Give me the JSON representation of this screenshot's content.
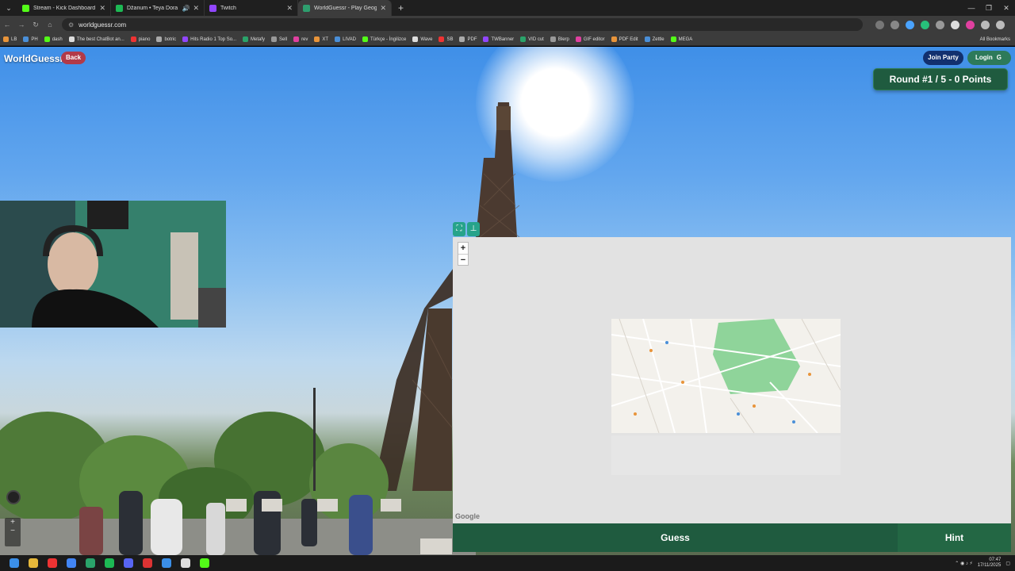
{
  "browser": {
    "tabs": [
      {
        "title": "Stream - Kick Dashboard",
        "color": "#53fc18",
        "active": false
      },
      {
        "title": "Džanum • Teya Dora",
        "color": "#1db954",
        "active": false
      },
      {
        "title": "Twitch",
        "color": "#9146ff",
        "active": false
      },
      {
        "title": "WorldGuessr - Play Geoguessr",
        "color": "#2e9e6e",
        "active": true
      }
    ],
    "url": "worldguessr.com",
    "bookmarks": [
      "LB",
      "PH",
      "dash",
      "The best ChatBot an...",
      "piano",
      "botric",
      "Hits Radio 1 Top So...",
      "Metafy",
      "Sell",
      "rev",
      "XT",
      "LIVAD",
      "Türkçe - İngilizce",
      "Wave",
      "SB",
      "PDF",
      "TWBanner",
      "VID cut",
      "Blerp",
      "GIF editor",
      "PDF Edit",
      "Zettle",
      "MEGA"
    ],
    "all_bookmarks": "All Bookmarks"
  },
  "game": {
    "logo": "WorldGuessr",
    "back_label": "Back",
    "join_party_label": "Join Party",
    "login_label": "Login",
    "round_text": "Round #1 / 5 - 0 Points",
    "guess_label": "Guess",
    "hint_label": "Hint",
    "zoom_in": "+",
    "zoom_out": "−",
    "map_attribution": "Google"
  },
  "taskbar": {
    "time": "07:47",
    "date": "17/11/2025"
  },
  "colors": {
    "accent_green": "#1f5b3f",
    "back_red": "#b23a48",
    "join_blue": "#12306e"
  }
}
